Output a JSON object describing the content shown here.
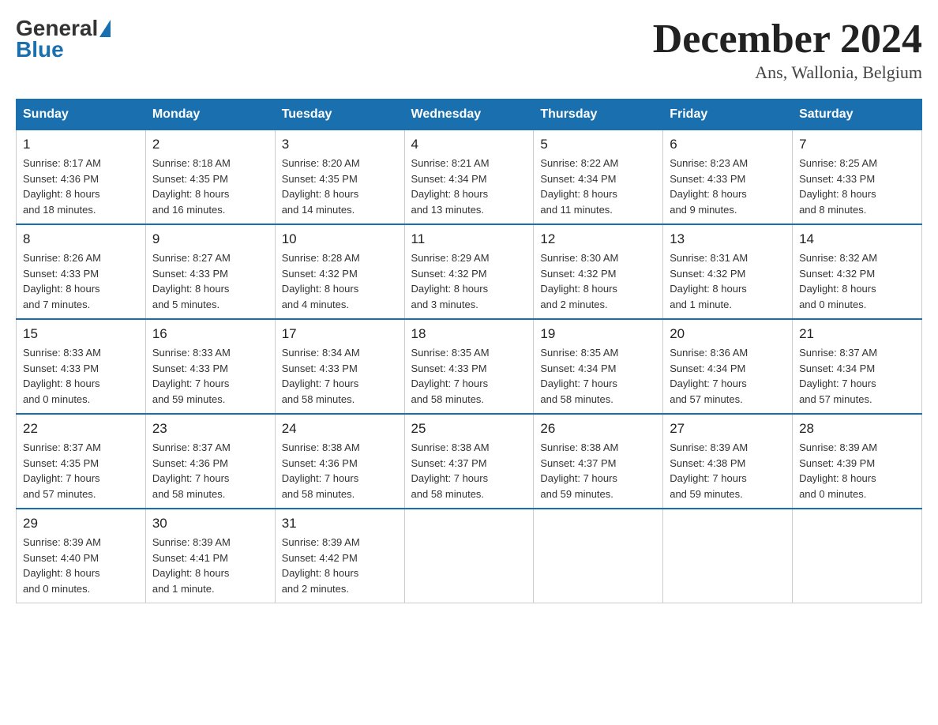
{
  "header": {
    "logo_general": "General",
    "logo_blue": "Blue",
    "month_title": "December 2024",
    "location": "Ans, Wallonia, Belgium"
  },
  "calendar": {
    "days_of_week": [
      "Sunday",
      "Monday",
      "Tuesday",
      "Wednesday",
      "Thursday",
      "Friday",
      "Saturday"
    ],
    "weeks": [
      [
        {
          "day": "1",
          "info": "Sunrise: 8:17 AM\nSunset: 4:36 PM\nDaylight: 8 hours\nand 18 minutes."
        },
        {
          "day": "2",
          "info": "Sunrise: 8:18 AM\nSunset: 4:35 PM\nDaylight: 8 hours\nand 16 minutes."
        },
        {
          "day": "3",
          "info": "Sunrise: 8:20 AM\nSunset: 4:35 PM\nDaylight: 8 hours\nand 14 minutes."
        },
        {
          "day": "4",
          "info": "Sunrise: 8:21 AM\nSunset: 4:34 PM\nDaylight: 8 hours\nand 13 minutes."
        },
        {
          "day": "5",
          "info": "Sunrise: 8:22 AM\nSunset: 4:34 PM\nDaylight: 8 hours\nand 11 minutes."
        },
        {
          "day": "6",
          "info": "Sunrise: 8:23 AM\nSunset: 4:33 PM\nDaylight: 8 hours\nand 9 minutes."
        },
        {
          "day": "7",
          "info": "Sunrise: 8:25 AM\nSunset: 4:33 PM\nDaylight: 8 hours\nand 8 minutes."
        }
      ],
      [
        {
          "day": "8",
          "info": "Sunrise: 8:26 AM\nSunset: 4:33 PM\nDaylight: 8 hours\nand 7 minutes."
        },
        {
          "day": "9",
          "info": "Sunrise: 8:27 AM\nSunset: 4:33 PM\nDaylight: 8 hours\nand 5 minutes."
        },
        {
          "day": "10",
          "info": "Sunrise: 8:28 AM\nSunset: 4:32 PM\nDaylight: 8 hours\nand 4 minutes."
        },
        {
          "day": "11",
          "info": "Sunrise: 8:29 AM\nSunset: 4:32 PM\nDaylight: 8 hours\nand 3 minutes."
        },
        {
          "day": "12",
          "info": "Sunrise: 8:30 AM\nSunset: 4:32 PM\nDaylight: 8 hours\nand 2 minutes."
        },
        {
          "day": "13",
          "info": "Sunrise: 8:31 AM\nSunset: 4:32 PM\nDaylight: 8 hours\nand 1 minute."
        },
        {
          "day": "14",
          "info": "Sunrise: 8:32 AM\nSunset: 4:32 PM\nDaylight: 8 hours\nand 0 minutes."
        }
      ],
      [
        {
          "day": "15",
          "info": "Sunrise: 8:33 AM\nSunset: 4:33 PM\nDaylight: 8 hours\nand 0 minutes."
        },
        {
          "day": "16",
          "info": "Sunrise: 8:33 AM\nSunset: 4:33 PM\nDaylight: 7 hours\nand 59 minutes."
        },
        {
          "day": "17",
          "info": "Sunrise: 8:34 AM\nSunset: 4:33 PM\nDaylight: 7 hours\nand 58 minutes."
        },
        {
          "day": "18",
          "info": "Sunrise: 8:35 AM\nSunset: 4:33 PM\nDaylight: 7 hours\nand 58 minutes."
        },
        {
          "day": "19",
          "info": "Sunrise: 8:35 AM\nSunset: 4:34 PM\nDaylight: 7 hours\nand 58 minutes."
        },
        {
          "day": "20",
          "info": "Sunrise: 8:36 AM\nSunset: 4:34 PM\nDaylight: 7 hours\nand 57 minutes."
        },
        {
          "day": "21",
          "info": "Sunrise: 8:37 AM\nSunset: 4:34 PM\nDaylight: 7 hours\nand 57 minutes."
        }
      ],
      [
        {
          "day": "22",
          "info": "Sunrise: 8:37 AM\nSunset: 4:35 PM\nDaylight: 7 hours\nand 57 minutes."
        },
        {
          "day": "23",
          "info": "Sunrise: 8:37 AM\nSunset: 4:36 PM\nDaylight: 7 hours\nand 58 minutes."
        },
        {
          "day": "24",
          "info": "Sunrise: 8:38 AM\nSunset: 4:36 PM\nDaylight: 7 hours\nand 58 minutes."
        },
        {
          "day": "25",
          "info": "Sunrise: 8:38 AM\nSunset: 4:37 PM\nDaylight: 7 hours\nand 58 minutes."
        },
        {
          "day": "26",
          "info": "Sunrise: 8:38 AM\nSunset: 4:37 PM\nDaylight: 7 hours\nand 59 minutes."
        },
        {
          "day": "27",
          "info": "Sunrise: 8:39 AM\nSunset: 4:38 PM\nDaylight: 7 hours\nand 59 minutes."
        },
        {
          "day": "28",
          "info": "Sunrise: 8:39 AM\nSunset: 4:39 PM\nDaylight: 8 hours\nand 0 minutes."
        }
      ],
      [
        {
          "day": "29",
          "info": "Sunrise: 8:39 AM\nSunset: 4:40 PM\nDaylight: 8 hours\nand 0 minutes."
        },
        {
          "day": "30",
          "info": "Sunrise: 8:39 AM\nSunset: 4:41 PM\nDaylight: 8 hours\nand 1 minute."
        },
        {
          "day": "31",
          "info": "Sunrise: 8:39 AM\nSunset: 4:42 PM\nDaylight: 8 hours\nand 2 minutes."
        },
        {
          "day": "",
          "info": ""
        },
        {
          "day": "",
          "info": ""
        },
        {
          "day": "",
          "info": ""
        },
        {
          "day": "",
          "info": ""
        }
      ]
    ]
  }
}
